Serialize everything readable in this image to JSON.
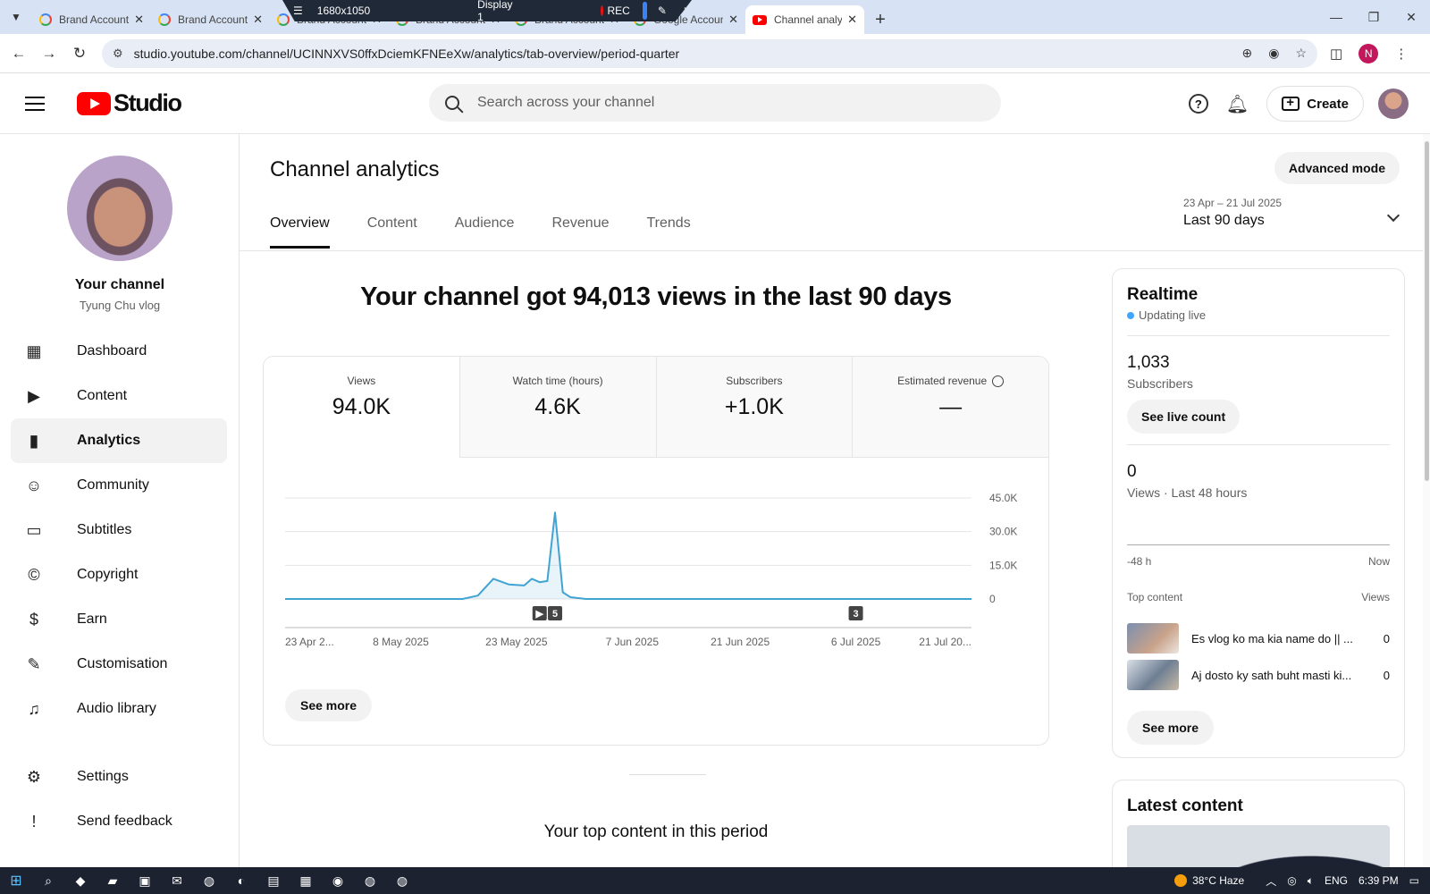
{
  "browser": {
    "tabs": [
      {
        "title": "Brand Account",
        "active": false
      },
      {
        "title": "Brand Account",
        "active": false
      },
      {
        "title": "Brand Account",
        "active": false
      },
      {
        "title": "Brand Account",
        "active": false
      },
      {
        "title": "Brand Account",
        "active": false
      },
      {
        "title": "Google Account",
        "active": false
      },
      {
        "title": "Channel analytics",
        "active": true
      }
    ],
    "url": "studio.youtube.com/channel/UCINNXVS0ffxDciemKFNEeXw/analytics/tab-overview/period-quarter",
    "profile_initial": "N"
  },
  "recorder": {
    "resolution": "1680x1050",
    "display": "Display 1",
    "rec_label": "REC"
  },
  "header": {
    "logo_text": "Studio",
    "search_placeholder": "Search across your channel",
    "help_glyph": "?",
    "create_label": "Create"
  },
  "sidebar": {
    "channel_label": "Your channel",
    "channel_name": "Tyung Chu vlog",
    "items": [
      {
        "label": "Dashboard",
        "icon": "dashboard-icon",
        "glyph": "▦",
        "active": false
      },
      {
        "label": "Content",
        "icon": "content-icon",
        "glyph": "▶",
        "active": false
      },
      {
        "label": "Analytics",
        "icon": "analytics-icon",
        "glyph": "▮",
        "active": true
      },
      {
        "label": "Community",
        "icon": "community-icon",
        "glyph": "☺",
        "active": false
      },
      {
        "label": "Subtitles",
        "icon": "subtitles-icon",
        "glyph": "▭",
        "active": false
      },
      {
        "label": "Copyright",
        "icon": "copyright-icon",
        "glyph": "©",
        "active": false
      },
      {
        "label": "Earn",
        "icon": "earn-icon",
        "glyph": "$",
        "active": false
      },
      {
        "label": "Customisation",
        "icon": "customisation-icon",
        "glyph": "✎",
        "active": false
      },
      {
        "label": "Audio library",
        "icon": "audio-library-icon",
        "glyph": "♫",
        "active": false
      }
    ],
    "bottom_items": [
      {
        "label": "Settings",
        "icon": "settings-icon",
        "glyph": "⚙"
      },
      {
        "label": "Send feedback",
        "icon": "feedback-icon",
        "glyph": "!"
      }
    ]
  },
  "main": {
    "title": "Channel analytics",
    "advanced_mode_label": "Advanced mode",
    "tabs": [
      {
        "label": "Overview",
        "active": true
      },
      {
        "label": "Content",
        "active": false
      },
      {
        "label": "Audience",
        "active": false
      },
      {
        "label": "Revenue",
        "active": false
      },
      {
        "label": "Trends",
        "active": false
      }
    ],
    "date_range": "23 Apr – 21 Jul 2025",
    "period_label": "Last 90 days",
    "headline": "Your channel got 94,013 views in the last 90 days",
    "metrics": [
      {
        "label": "Views",
        "value": "94.0K",
        "active": true
      },
      {
        "label": "Watch time (hours)",
        "value": "4.6K",
        "active": false
      },
      {
        "label": "Subscribers",
        "value": "+1.0K",
        "active": false
      },
      {
        "label": "Estimated revenue",
        "value": "—",
        "active": false
      }
    ],
    "see_more_label": "See more",
    "top_content_title": "Your top content in this period"
  },
  "chart_data": {
    "type": "line",
    "series": [
      {
        "x": [
          "2025-04-23",
          "2025-04-28",
          "2025-05-03",
          "2025-05-08",
          "2025-05-13",
          "2025-05-16",
          "2025-05-18",
          "2025-05-20",
          "2025-05-22",
          "2025-05-24",
          "2025-05-25",
          "2025-05-26",
          "2025-05-27",
          "2025-05-28",
          "2025-05-29",
          "2025-05-30",
          "2025-06-01",
          "2025-06-07",
          "2025-06-14",
          "2025-06-21",
          "2025-06-28",
          "2025-07-06",
          "2025-07-14",
          "2025-07-21"
        ],
        "values": [
          0,
          0,
          0,
          0,
          0,
          0,
          1500,
          9000,
          6500,
          6000,
          9000,
          7500,
          8000,
          38500,
          3000,
          800,
          0,
          0,
          0,
          0,
          0,
          0,
          0,
          0
        ]
      }
    ],
    "x_tick_labels": [
      "23 Apr 2...",
      "8 May 2025",
      "23 May 2025",
      "7 Jun 2025",
      "21 Jun 2025",
      "6 Jul 2025",
      "21 Jul 20..."
    ],
    "x_tick_dates": [
      "2025-04-23",
      "2025-05-08",
      "2025-05-23",
      "2025-06-07",
      "2025-06-21",
      "2025-07-06",
      "2025-07-21"
    ],
    "y_ticks": [
      0,
      15000,
      30000,
      45000
    ],
    "y_tick_labels": [
      "0",
      "15.0K",
      "30.0K",
      "45.0K"
    ],
    "ylim": [
      0,
      45000
    ],
    "grid": true,
    "markers": [
      {
        "date": "2025-05-26",
        "label": "▶",
        "kind": "play"
      },
      {
        "date": "2025-05-28",
        "label": "5",
        "kind": "count"
      },
      {
        "date": "2025-07-06",
        "label": "3",
        "kind": "count"
      }
    ],
    "line_color": "#41a3d1"
  },
  "realtime": {
    "title": "Realtime",
    "status": "Updating live",
    "subscribers": "1,033",
    "subscribers_label": "Subscribers",
    "live_count_label": "See live count",
    "views": "0",
    "views_label": "Views · Last 48 hours",
    "axis_start": "-48 h",
    "axis_end": "Now",
    "top_content_label": "Top content",
    "views_col_label": "Views",
    "top_items": [
      {
        "title": "Es vlog ko ma kia name do || ...",
        "views": "0"
      },
      {
        "title": "Aj dosto ky sath buht masti ki...",
        "views": "0"
      }
    ],
    "see_more_label": "See more"
  },
  "latest_content": {
    "title": "Latest content"
  },
  "taskbar": {
    "weather": "38°C  Haze",
    "lang": "ENG",
    "time": "6:39 PM"
  }
}
